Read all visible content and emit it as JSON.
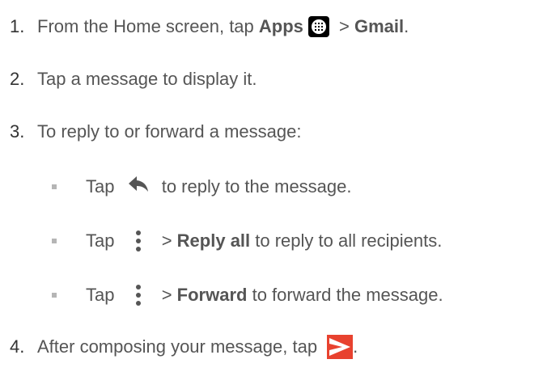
{
  "steps": [
    {
      "num": "1.",
      "pre": "From the Home screen, tap ",
      "apps": "Apps",
      "sep": " > ",
      "gmail": "Gmail",
      "post": "."
    },
    {
      "num": "2.",
      "text": "Tap a message to display it."
    },
    {
      "num": "3.",
      "text": "To reply to or forward a message:"
    },
    {
      "num": "4.",
      "pre": "After composing your message, tap ",
      "post": "."
    }
  ],
  "bullets": [
    {
      "pre": "Tap ",
      "post": " to reply to the message."
    },
    {
      "pre": "Tap ",
      "sep": " > ",
      "bold": "Reply all",
      "post": " to reply to all recipients."
    },
    {
      "pre": "Tap ",
      "sep": " > ",
      "bold": "Forward",
      "post": " to forward the message."
    }
  ],
  "icons": {
    "apps": "apps-grid-icon",
    "reply": "reply-arrow-icon",
    "more": "more-vert-icon",
    "send": "send-icon"
  },
  "colors": {
    "text": "#555555",
    "number": "#333333",
    "send_bg": "#e8422f",
    "bullet": "#b5b5b5"
  }
}
